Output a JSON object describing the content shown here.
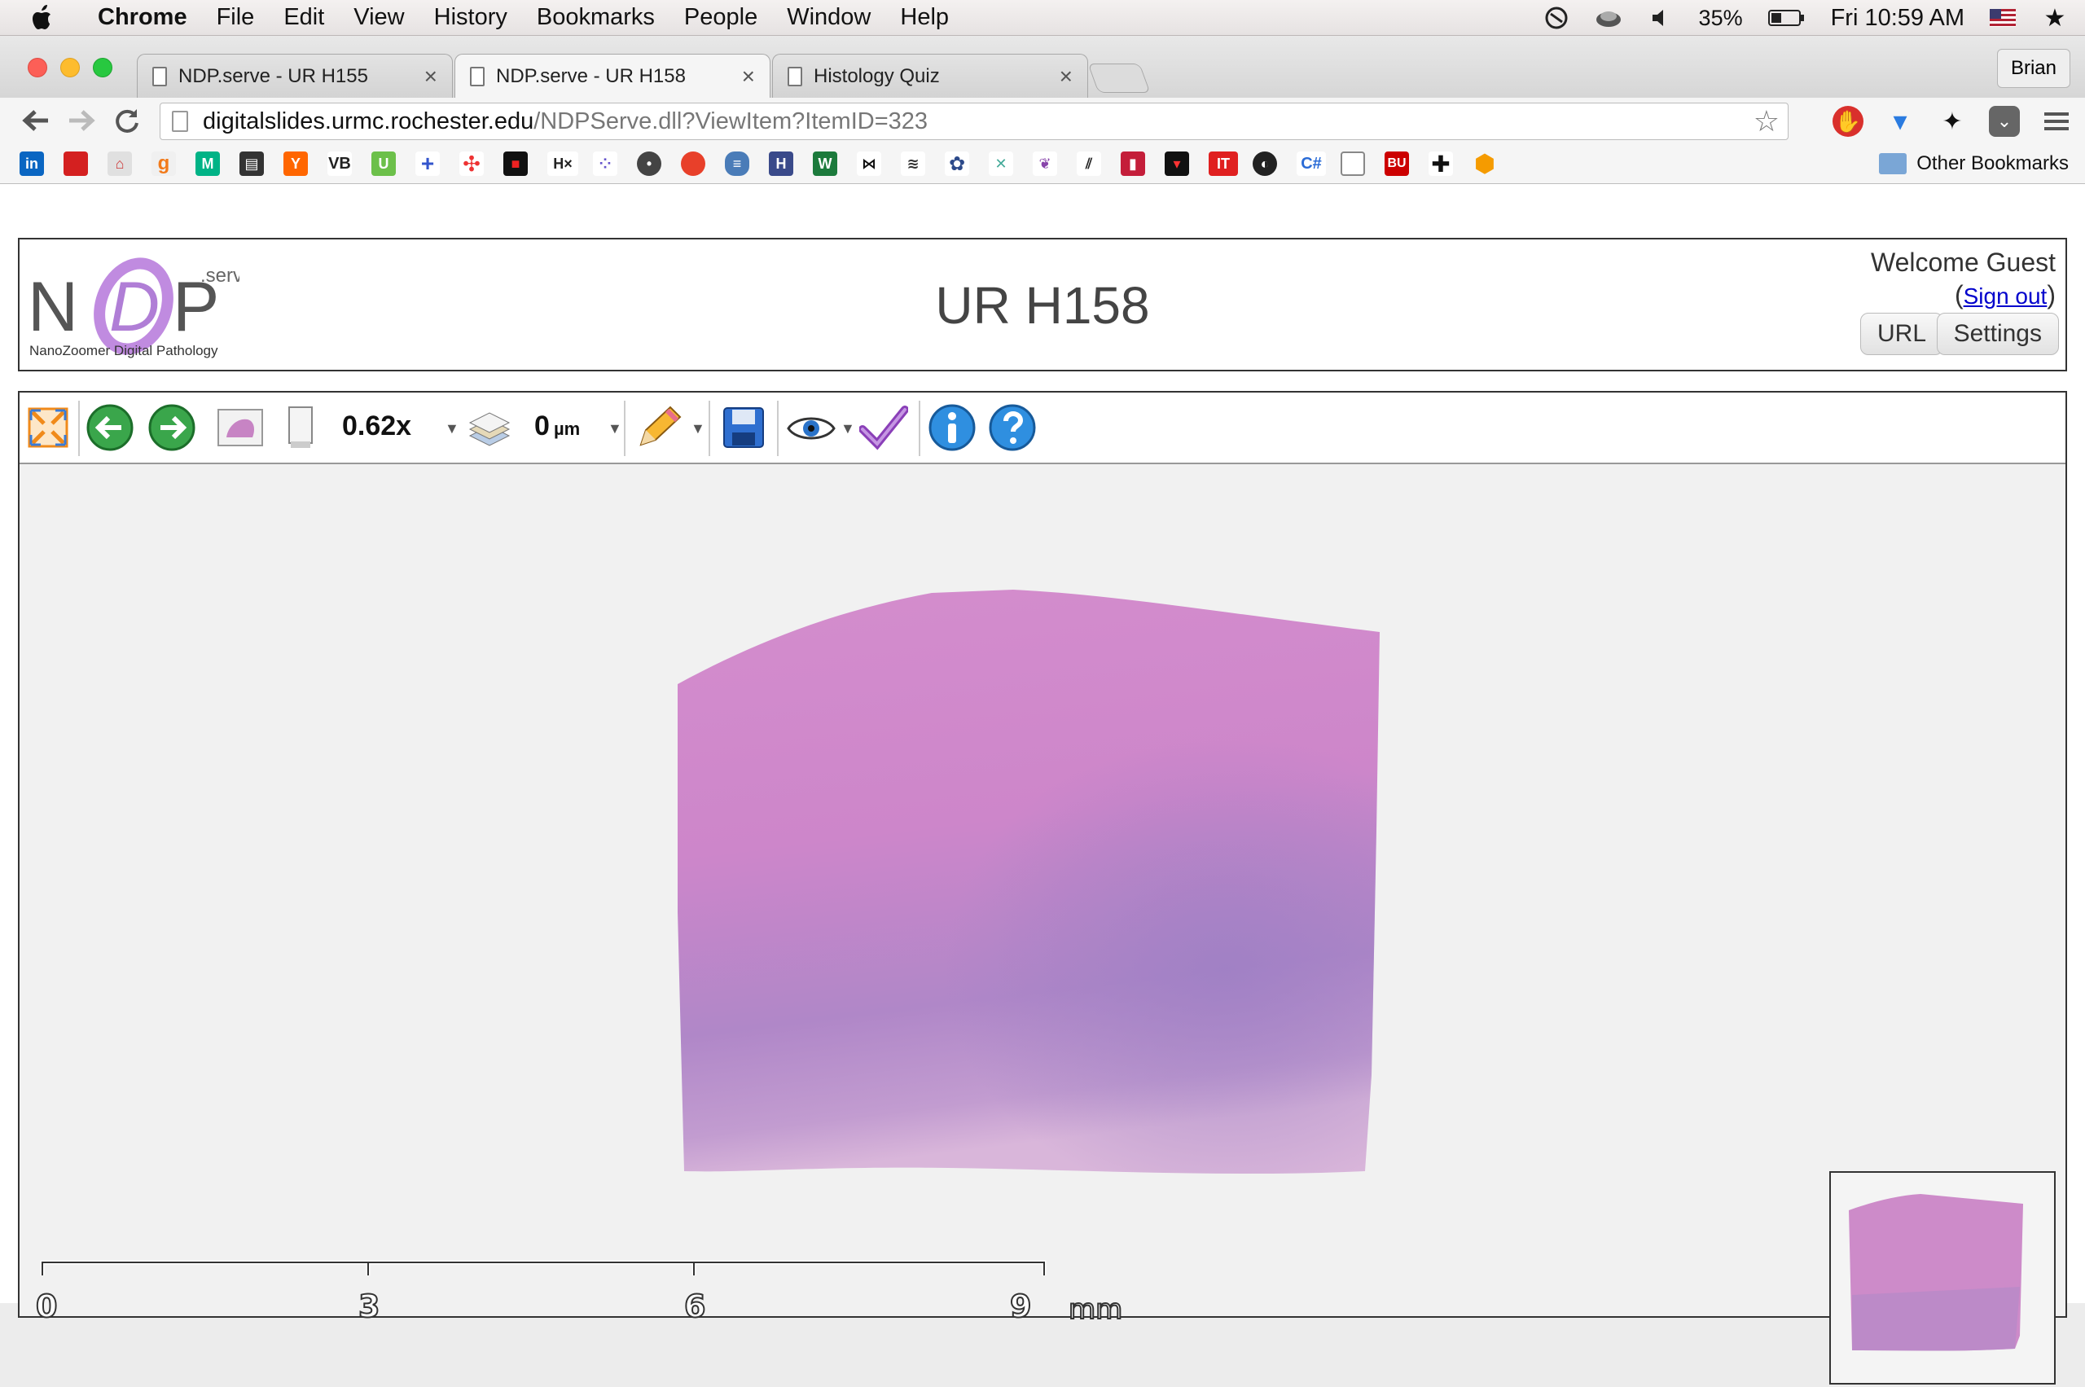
{
  "menubar": {
    "app_name": "Chrome",
    "items": [
      "File",
      "Edit",
      "View",
      "History",
      "Bookmarks",
      "People",
      "Window",
      "Help"
    ],
    "battery": "35%",
    "clock": "Fri 10:59 AM"
  },
  "browser": {
    "tabs": [
      {
        "title": "NDP.serve - UR H155",
        "active": false
      },
      {
        "title": "NDP.serve - UR H158",
        "active": true
      },
      {
        "title": "Histology Quiz",
        "active": false
      }
    ],
    "profile": "Brian",
    "url_host": "digitalslides.urmc.rochester.edu",
    "url_path": "/NDPServe.dll?ViewItem?ItemID=323",
    "other_bookmarks": "Other Bookmarks",
    "bookmark_glyphs": [
      "in",
      "",
      "",
      "g",
      "",
      "",
      "Y",
      "VB",
      "U",
      "+",
      "",
      "",
      "H×",
      "",
      "",
      "",
      "",
      "H",
      "W",
      "",
      "",
      "",
      "",
      "",
      "",
      "",
      "",
      "",
      "IT",
      "",
      "C#",
      "",
      "BU",
      "",
      ""
    ]
  },
  "ndp": {
    "logo_top": ".serve",
    "logo_main_n": "N",
    "logo_main_d": "D",
    "logo_main_p": "P",
    "logo_sub": "NanoZoomer Digital Pathology",
    "title": "UR H158",
    "welcome": "Welcome Guest",
    "signout_open": "(",
    "signout": "Sign out",
    "signout_close": ")",
    "url_button": "URL",
    "settings_button": "Settings",
    "zoom": "0.62x",
    "focus_value": "0",
    "focus_unit": "µm",
    "scale_labels": [
      "0",
      "3",
      "6",
      "9"
    ],
    "scale_unit": "mm"
  },
  "colors": {
    "tissue_pink": "#cf86c9",
    "tissue_purple": "#a884c4",
    "apple_close": "#fc5f57",
    "apple_min": "#fdbc2e",
    "apple_max": "#28c840"
  }
}
